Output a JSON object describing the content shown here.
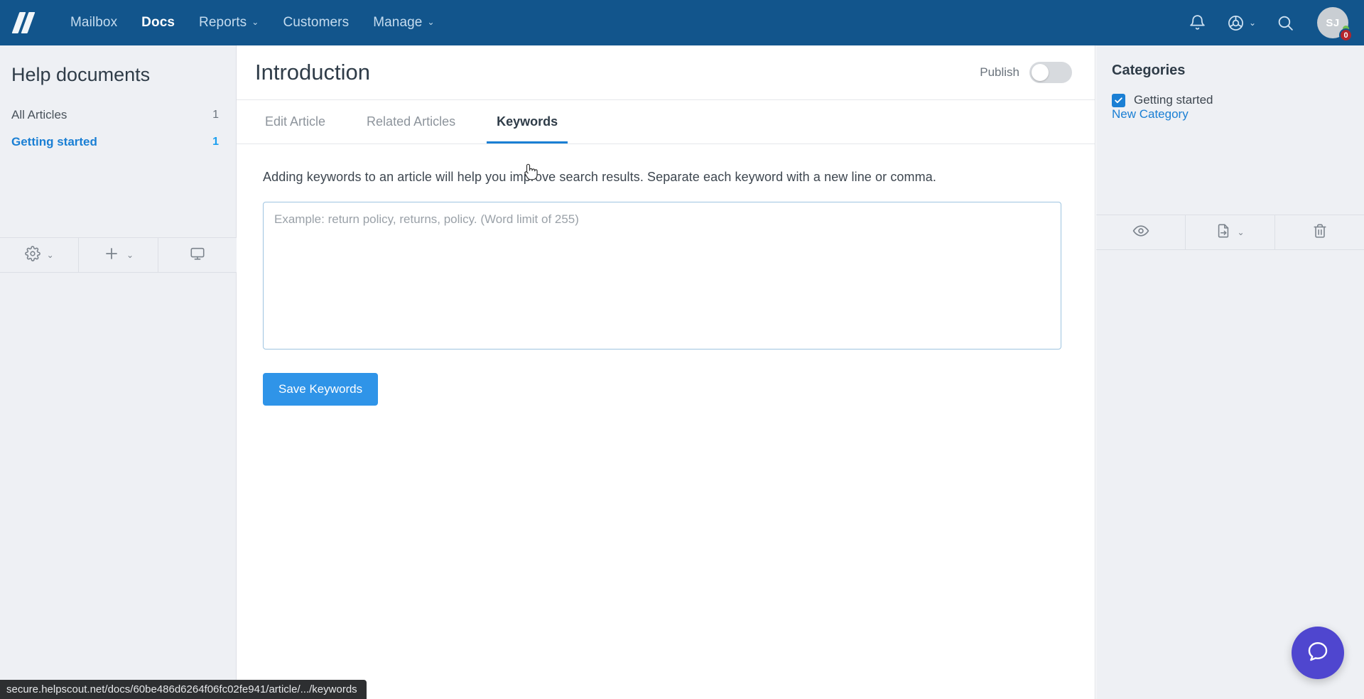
{
  "topnav": {
    "brand": "helpscout-logo",
    "links": [
      {
        "label": "Mailbox",
        "active": false,
        "caret": ""
      },
      {
        "label": "Docs",
        "active": true,
        "caret": ""
      },
      {
        "label": "Reports",
        "active": false,
        "caret": "⌄"
      },
      {
        "label": "Customers",
        "active": false,
        "caret": ""
      },
      {
        "label": "Manage",
        "active": false,
        "caret": "⌄"
      }
    ],
    "icons": {
      "notifications": "bell-icon",
      "help": "lifesaver-icon",
      "help_caret": "⌄",
      "search": "search-icon"
    },
    "avatar": {
      "initials": "SJ",
      "badge_count": "0"
    }
  },
  "sidebar": {
    "title": "Help documents",
    "items": [
      {
        "label": "All Articles",
        "count": "1",
        "selected": false
      },
      {
        "label": "Getting started",
        "count": "1",
        "selected": true
      }
    ],
    "tools": [
      {
        "name": "gear-icon",
        "caret": "⌄"
      },
      {
        "name": "plus-icon",
        "caret": "⌄"
      },
      {
        "name": "monitor-icon",
        "caret": ""
      }
    ]
  },
  "main": {
    "article_title": "Introduction",
    "publish_label": "Publish",
    "publish_on": false,
    "tabs": [
      {
        "label": "Edit Article",
        "active": false
      },
      {
        "label": "Related Articles",
        "active": false
      },
      {
        "label": "Keywords",
        "active": true
      }
    ],
    "keywords": {
      "hint": "Adding keywords to an article will help you improve search results. Separate each keyword with a new line or comma.",
      "placeholder": "Example: return policy, returns, policy. (Word limit of 255)",
      "value": "",
      "save_label": "Save Keywords"
    }
  },
  "rightpanel": {
    "title": "Categories",
    "categories": [
      {
        "label": "Getting started",
        "checked": true
      }
    ],
    "new_category_label": "New Category",
    "tools": [
      {
        "name": "eye-icon",
        "caret": ""
      },
      {
        "name": "move-article-icon",
        "caret": "⌄"
      },
      {
        "name": "trash-icon",
        "caret": ""
      }
    ]
  },
  "statusbar": {
    "url": "secure.helpscout.net/docs/60be486d6264f06fc02fe941/article/.../keywords"
  },
  "beacon": {
    "name": "chat-bubble-icon"
  },
  "colors": {
    "nav_bg": "#12558c",
    "accent_blue": "#1a7fd4",
    "button_blue": "#2f94e8",
    "panel_bg": "#eef0f4",
    "beacon_purple": "#4f46cf",
    "badge_red": "#b3242b"
  }
}
